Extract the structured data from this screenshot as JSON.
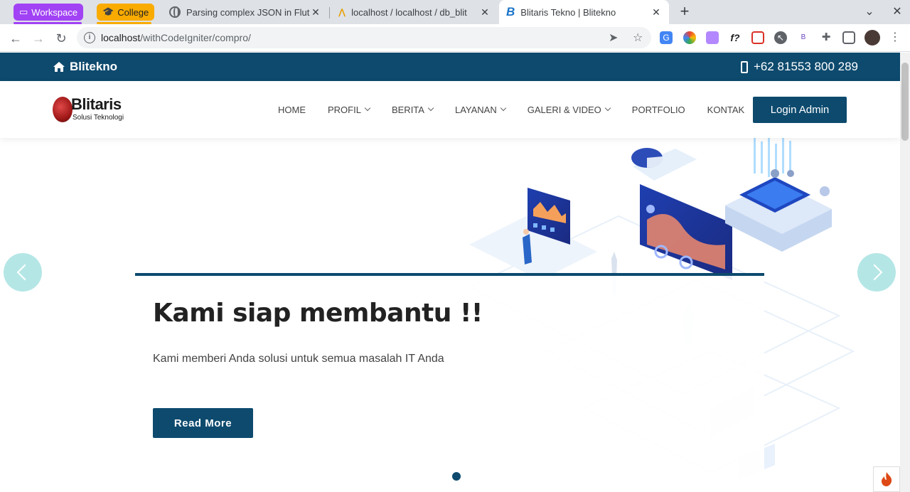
{
  "browser": {
    "tab_groups": [
      {
        "label": "Workspace",
        "color": "#a142f4"
      },
      {
        "label": "College",
        "color": "#f9ab00"
      }
    ],
    "tabs": [
      {
        "title": "Parsing complex JSON in Flut",
        "active": false
      },
      {
        "title": "localhost / localhost / db_blit",
        "active": false
      },
      {
        "title": "Blitaris Tekno | Blitekno",
        "active": true
      }
    ],
    "address": {
      "host": "localhost",
      "path": "/withCodeIgniter/compro/"
    }
  },
  "topbar": {
    "brand": "Blitekno",
    "phone": "+62 81553 800 289"
  },
  "header": {
    "logo_name": "Blitaris",
    "logo_tagline": "Solusi Teknologi",
    "nav": [
      {
        "label": "HOME",
        "dropdown": false
      },
      {
        "label": "PROFIL",
        "dropdown": true
      },
      {
        "label": "BERITA",
        "dropdown": true
      },
      {
        "label": "LAYANAN",
        "dropdown": true
      },
      {
        "label": "GALERI & VIDEO",
        "dropdown": true
      },
      {
        "label": "PORTFOLIO",
        "dropdown": false
      },
      {
        "label": "KONTAK",
        "dropdown": false
      }
    ],
    "login_label": "Login Admin"
  },
  "hero": {
    "heading": "Kami siap membantu !!",
    "text": "Kami memberi Anda solusi untuk semua masalah IT Anda",
    "button": "Read More"
  },
  "colors": {
    "primary": "#0d4a6e",
    "arrow": "#78d2d2"
  }
}
